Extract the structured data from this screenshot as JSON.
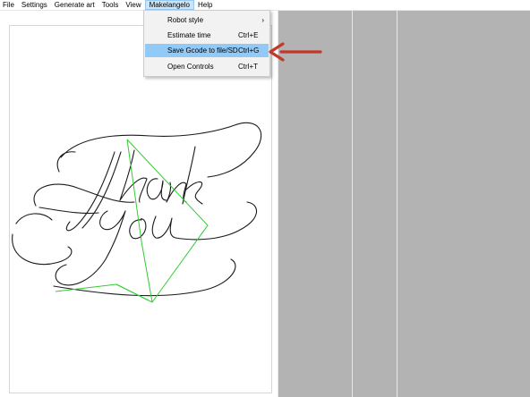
{
  "menubar": {
    "items": [
      "File",
      "Settings",
      "Generate art",
      "Tools",
      "View",
      "Makelangelo",
      "Help"
    ]
  },
  "dropdown": {
    "items": [
      {
        "label": "Robot style",
        "shortcut": "",
        "submenu_arrow": "›"
      },
      {
        "label": "Estimate time",
        "shortcut": "Ctrl+E"
      },
      {
        "label": "Save Gcode to file/SD",
        "shortcut": "Ctrl+G"
      },
      {
        "label": "Open Controls",
        "shortcut": "Ctrl+T"
      }
    ]
  },
  "colors": {
    "highlight": "#91c9f7",
    "arrow": "#c0392b",
    "travel_path": "#33cc33",
    "stroke": "#1a1a1a"
  },
  "icons": {
    "submenu": "chevron-right-icon",
    "callout": "arrow-left-icon"
  }
}
